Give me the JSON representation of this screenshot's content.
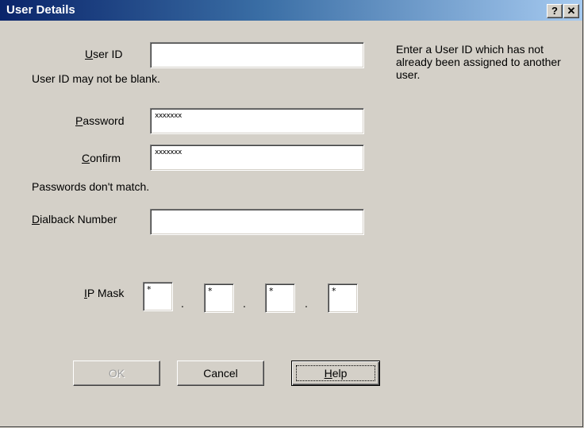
{
  "window": {
    "title": "User Details",
    "help_button": "?",
    "close_button": "✕"
  },
  "form": {
    "user_id": {
      "label": "User ID",
      "accel": "U",
      "rest": "ser ID",
      "value": ""
    },
    "user_id_error": "User ID may not be blank.",
    "password": {
      "label": "Password",
      "accel": "P",
      "rest": "assword",
      "value": "xxxxxxx"
    },
    "confirm": {
      "label": "Confirm",
      "accel": "C",
      "rest": "onfirm",
      "value": "xxxxxxx"
    },
    "password_error": "Passwords don't match.",
    "dialback": {
      "label": "Dialback Number",
      "accel": "D",
      "rest": "ialback Number",
      "value": ""
    },
    "ip_mask": {
      "label": "IP Mask",
      "accel": "I",
      "rest": "P Mask",
      "octets": [
        "*",
        "*",
        "*",
        "*"
      ],
      "separator": "."
    }
  },
  "hint_text": "Enter a User ID which has not already been assigned to another user.",
  "buttons": {
    "ok": "OK",
    "cancel": "Cancel",
    "help": {
      "label": "Help",
      "accel": "H",
      "rest": "elp"
    }
  }
}
